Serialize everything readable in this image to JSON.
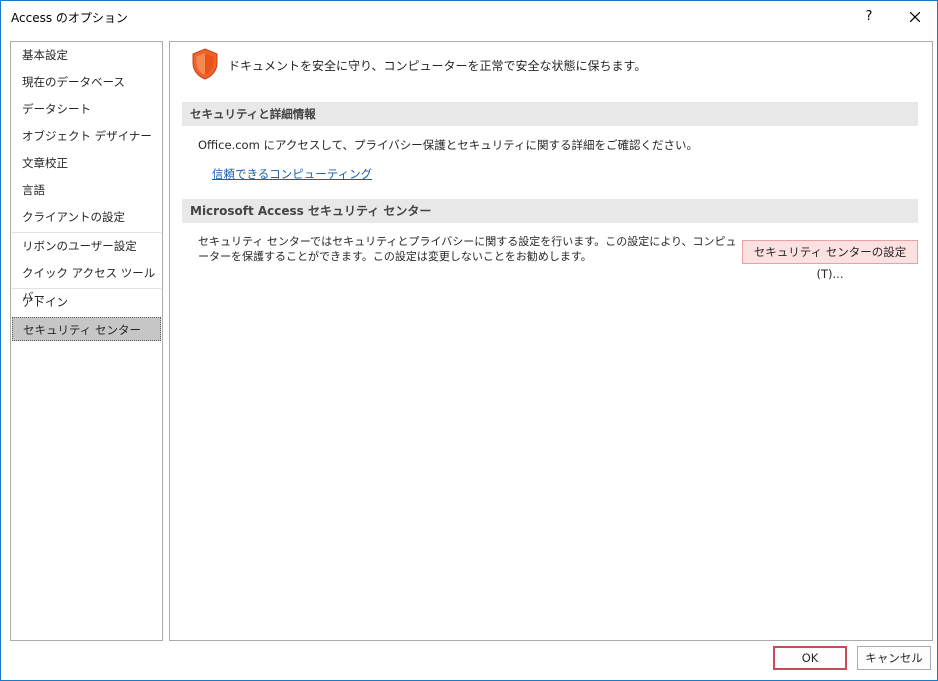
{
  "window": {
    "title": "Access のオプション",
    "help_label": "?",
    "close_icon": "close-icon"
  },
  "sidebar": {
    "items": [
      {
        "label": "基本設定"
      },
      {
        "label": "現在のデータベース"
      },
      {
        "label": "データシート"
      },
      {
        "label": "オブジェクト デザイナー"
      },
      {
        "label": "文章校正"
      },
      {
        "label": "言語"
      },
      {
        "label": "クライアントの設定"
      },
      {
        "label": "リボンのユーザー設定"
      },
      {
        "label": "クイック アクセス ツール バー"
      },
      {
        "label": "アドイン"
      },
      {
        "label": "セキュリティ センター",
        "selected": true
      }
    ]
  },
  "content": {
    "header_icon": "shield-icon",
    "header_text": "ドキュメントを安全に守り、コンピューターを正常で安全な状態に保ちます。",
    "privacy_section": {
      "title": "セキュリティと詳細情報",
      "description": "Office.com にアクセスして、プライバシー保護とセキュリティに関する詳細をご確認ください。",
      "link": "信頼できるコンピューティング"
    },
    "trust_center_section": {
      "title": "Microsoft Access セキュリティ センター",
      "description": "セキュリティ センターではセキュリティとプライバシーに関する設定を行います。この設定により、コンピューターを保護することができます。この設定は変更しないことをお勧めします。",
      "button_label": "セキュリティ センターの設定(T)..."
    }
  },
  "footer": {
    "ok_label": "OK",
    "cancel_label": "キャンセル"
  },
  "colors": {
    "accent_border": "#1979ca",
    "shield_orange": "#f0622a",
    "selected_nav": "#c6c6c6",
    "section_header": "#e8e8e8",
    "trust_button_bg": "#fde1e1",
    "ok_border": "#c84b57",
    "link": "#1a5ea8"
  }
}
